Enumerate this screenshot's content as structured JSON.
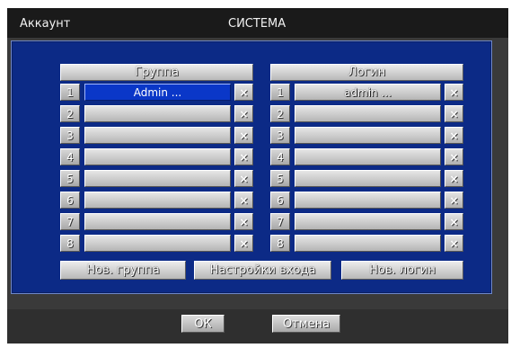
{
  "window": {
    "title_left": "Аккаунт",
    "title_center": "СИСТЕМА"
  },
  "groups": {
    "header": "Группа",
    "rows": [
      {
        "num": "1",
        "name": "Admin ...",
        "selected": true
      },
      {
        "num": "2",
        "name": ""
      },
      {
        "num": "3",
        "name": ""
      },
      {
        "num": "4",
        "name": ""
      },
      {
        "num": "5",
        "name": ""
      },
      {
        "num": "6",
        "name": ""
      },
      {
        "num": "7",
        "name": ""
      },
      {
        "num": "8",
        "name": ""
      }
    ],
    "delete_glyph": "×"
  },
  "logins": {
    "header": "Логин",
    "rows": [
      {
        "num": "1",
        "name": "admin ..."
      },
      {
        "num": "2",
        "name": ""
      },
      {
        "num": "3",
        "name": ""
      },
      {
        "num": "4",
        "name": ""
      },
      {
        "num": "5",
        "name": ""
      },
      {
        "num": "6",
        "name": ""
      },
      {
        "num": "7",
        "name": ""
      },
      {
        "num": "8",
        "name": ""
      }
    ],
    "delete_glyph": "×"
  },
  "actions": {
    "new_group": "Нов. группа",
    "login_settings": "Настройки входа",
    "new_login": "Нов. логин"
  },
  "footer": {
    "ok": "ОК",
    "cancel": "Отмена"
  },
  "colors": {
    "panel_blue": "#0c2a86",
    "selected_blue": "#0a37c8",
    "window_dark": "#0c0c0c"
  }
}
